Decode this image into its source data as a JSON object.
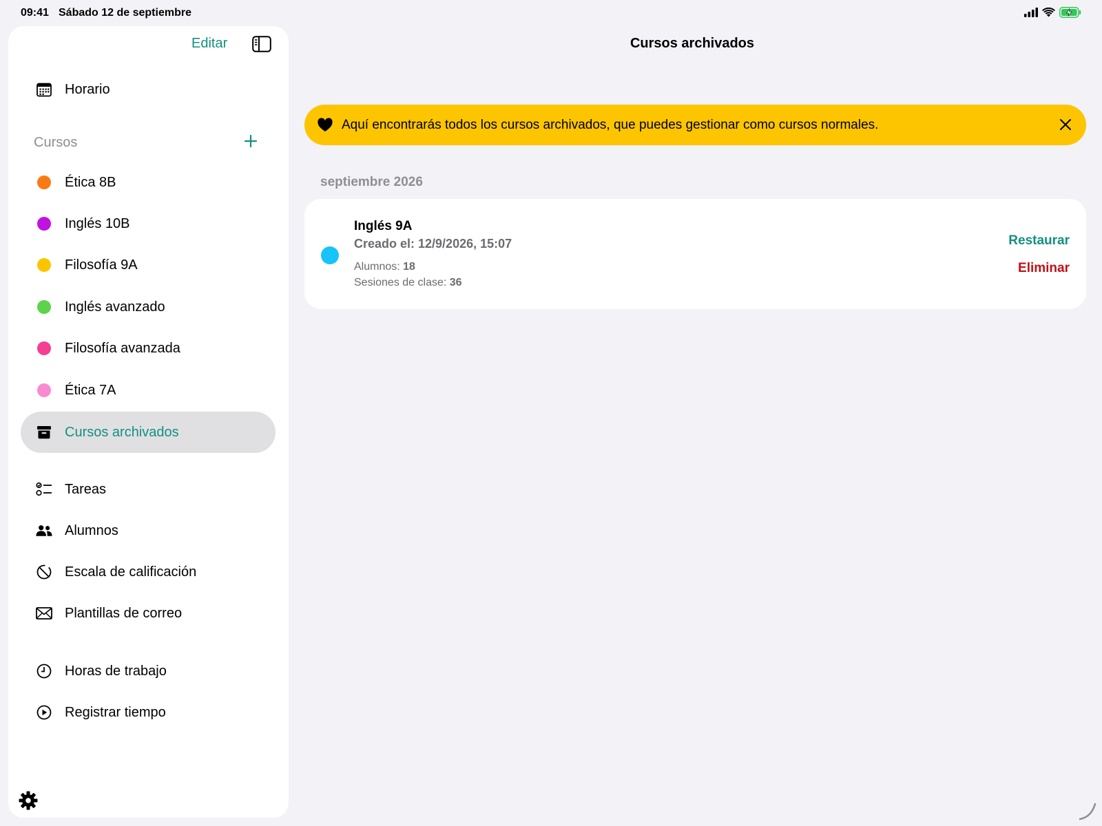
{
  "status_bar": {
    "time": "09:41",
    "date": "Sábado 12 de septiembre",
    "icons": [
      "signal-icon",
      "wifi-icon",
      "battery-charging-icon"
    ]
  },
  "sidebar": {
    "edit_label": "Editar",
    "schedule_label": "Horario",
    "courses_section_title": "Cursos",
    "courses": [
      {
        "label": "Ética 8B",
        "color": "#f97a12"
      },
      {
        "label": "Inglés 10B",
        "color": "#c013e0"
      },
      {
        "label": "Filosofía 9A",
        "color": "#fdc500"
      },
      {
        "label": "Inglés avanzado",
        "color": "#5dd24c"
      },
      {
        "label": "Filosofía avanzada",
        "color": "#f43f93"
      },
      {
        "label": "Ética 7A",
        "color": "#f98bd0"
      }
    ],
    "archived_label": "Cursos archivados",
    "tools": [
      {
        "label": "Tareas",
        "icon": "checklist-icon"
      },
      {
        "label": "Alumnos",
        "icon": "people-icon"
      },
      {
        "label": "Escala de calificación",
        "icon": "grading-scale-icon"
      },
      {
        "label": "Plantillas de correo",
        "icon": "envelope-icon"
      }
    ],
    "time_tools": [
      {
        "label": "Horas de trabajo",
        "icon": "clock-icon"
      },
      {
        "label": "Registrar tiempo",
        "icon": "play-circle-icon"
      }
    ]
  },
  "main": {
    "title": "Cursos archivados",
    "banner_text": "Aquí encontrarás todos los cursos archivados, que puedes gestionar como cursos normales.",
    "month_header": "septiembre 2026",
    "card": {
      "title": "Inglés 9A",
      "created": "Creado el: 12/9/2026, 15:07",
      "students_label": "Alumnos:",
      "students_value": "18",
      "sessions_label": "Sesiones de clase:",
      "sessions_value": "36",
      "dot_color": "#16c4f8",
      "restore_label": "Restaurar",
      "delete_label": "Eliminar"
    }
  },
  "colors": {
    "accent": "#148f80",
    "danger": "#c00f18",
    "banner": "#fdc500"
  }
}
